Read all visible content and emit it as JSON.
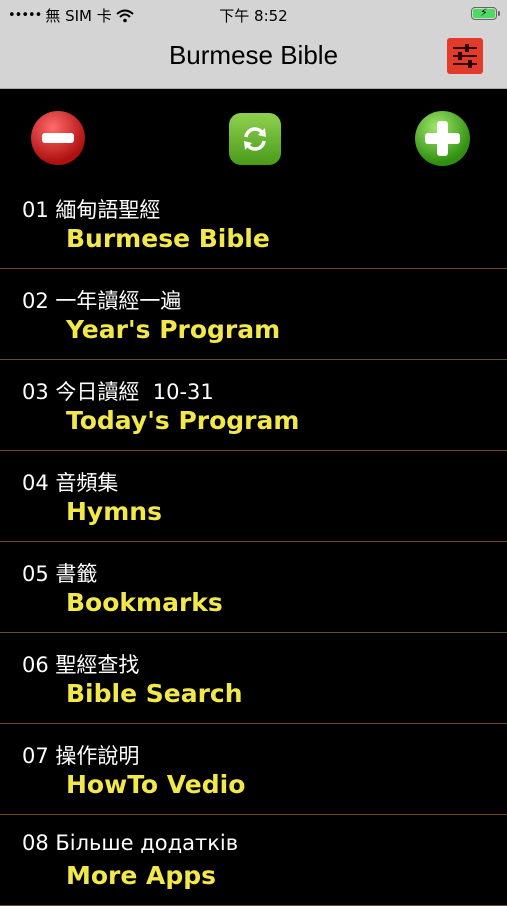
{
  "status_bar": {
    "carrier": "無 SIM 卡",
    "time": "下午 8:52"
  },
  "nav": {
    "title": "Burmese Bible",
    "settings_icon": "sliders-icon"
  },
  "toolbar": {
    "left_icon": "minus-circle-icon",
    "center_icon": "refresh-icon",
    "right_icon": "plus-circle-icon"
  },
  "menu": [
    {
      "line1": "01 緬甸語聖經",
      "line2": "Burmese Bible"
    },
    {
      "line1": "02 一年讀經一遍",
      "line2": "Year's Program"
    },
    {
      "line1": "03 今日讀經  10-31",
      "line2": "Today's Program"
    },
    {
      "line1": "04 音頻集",
      "line2": "Hymns"
    },
    {
      "line1": "05 書籤",
      "line2": "Bookmarks"
    },
    {
      "line1": "06 聖經查找",
      "line2": "Bible Search"
    },
    {
      "line1": "07 操作說明",
      "line2": "HowTo Vedio"
    },
    {
      "line1": "08 Більше додатків",
      "line2": "More Apps"
    }
  ],
  "colors": {
    "primary_text": "#ffffff",
    "secondary_text": "#f2e84a",
    "background": "#000000",
    "nav_background": "#d4d4d4",
    "divider": "#6b4c2a"
  }
}
